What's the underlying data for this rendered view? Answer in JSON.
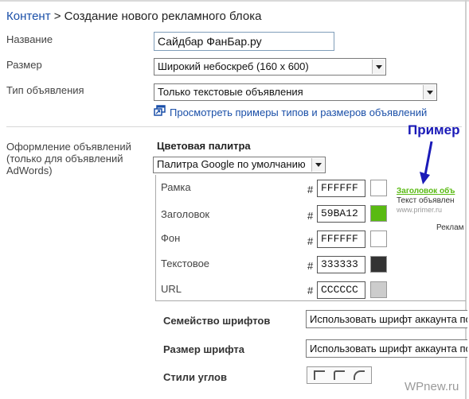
{
  "breadcrumb": {
    "link": "Контент",
    "separator": " > ",
    "title": "Создание нового рекламного блока"
  },
  "form": {
    "name_label": "Название",
    "name_value": "Сайдбар ФанБар.ру",
    "size_label": "Размер",
    "size_value": "Широкий небоскреб (160 x 600)",
    "type_label": "Тип объявления",
    "type_value": "Только текстовые объявления",
    "examples_link": "Просмотреть примеры типов и размеров объявлений"
  },
  "styling": {
    "section_label": "Оформление объявлений (только для объявлений AdWords)",
    "palette_title": "Цветовая палитра",
    "palette_value": "Палитра Google по умолчанию",
    "hash": "#",
    "colors": [
      {
        "label": "Рамка",
        "hex": "FFFFFF",
        "swatch": "#FFFFFF"
      },
      {
        "label": "Заголовок",
        "hex": "59BA12",
        "swatch": "#59BA12"
      },
      {
        "label": "Фон",
        "hex": "FFFFFF",
        "swatch": "#FFFFFF"
      },
      {
        "label": "Текстовое",
        "hex": "333333",
        "swatch": "#333333"
      },
      {
        "label": "URL",
        "hex": "CCCCCC",
        "swatch": "#CCCCCC"
      }
    ],
    "font_family_label": "Семейство шрифтов",
    "font_family_value": "Использовать шрифт аккаунта по",
    "font_size_label": "Размер шрифта",
    "font_size_value": "Использовать шрифт аккаунта по",
    "corner_label": "Стили углов",
    "corner_icons": [
      "square-corner-icon",
      "slightly-rounded-corner-icon",
      "rounded-corner-icon"
    ]
  },
  "preview": {
    "title": "Пример",
    "ad_headline": "Заголовок объ",
    "ad_text": "Текст объявлен",
    "ad_url": "www.primer.ru",
    "ad_label": "Реклам"
  },
  "watermark": "WPnew.ru",
  "colors": {
    "link": "#1a4fa8",
    "preview_title": "#1a1ab8",
    "arrow": "#1a1ab8",
    "headline_green": "#59BA12"
  }
}
